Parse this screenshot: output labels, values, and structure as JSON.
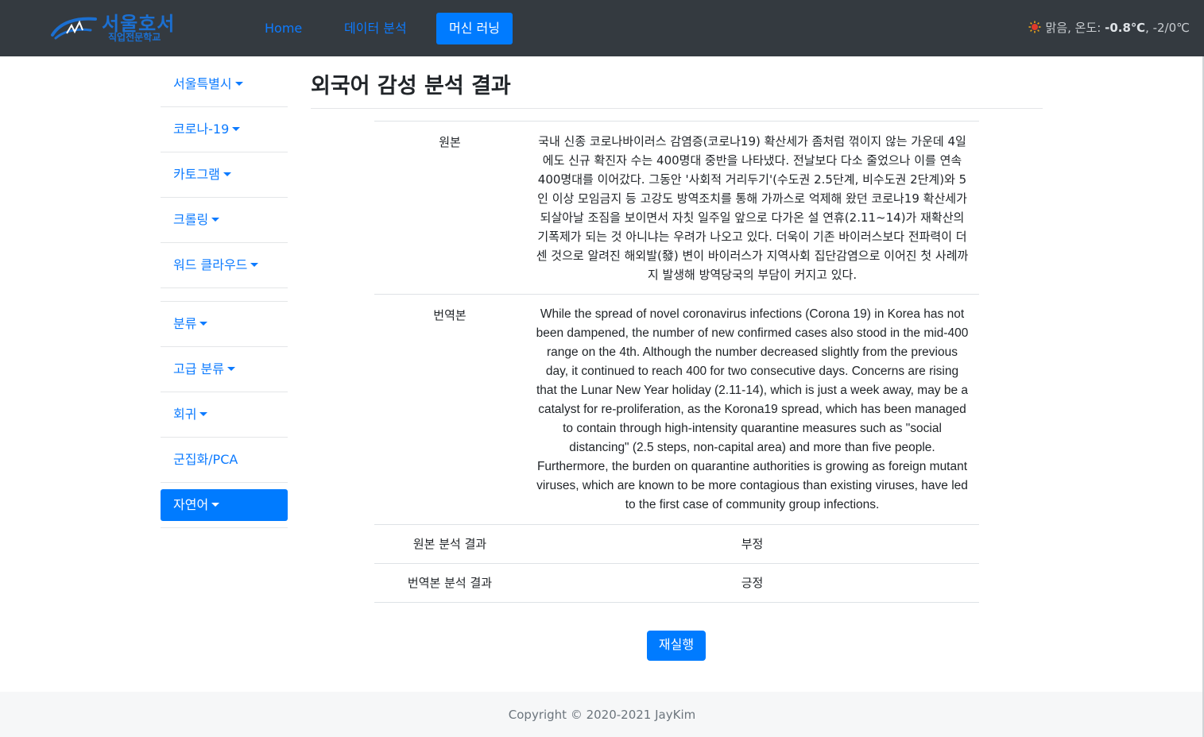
{
  "header": {
    "logo": {
      "line1": "서울호서",
      "line2": "직업전문학교"
    },
    "nav": [
      {
        "label": "Home",
        "active": false
      },
      {
        "label": "데이터 분석",
        "active": false
      },
      {
        "label": "머신 러닝",
        "active": true
      }
    ],
    "weather": {
      "icon": "sun-icon",
      "condition": "맑음, 온도: ",
      "temp": "-0.8℃",
      "range": ", -2/0℃"
    }
  },
  "sidebar": {
    "items": [
      {
        "label": "서울특별시",
        "dropdown": true
      },
      {
        "label": "코로나-19",
        "dropdown": true
      },
      {
        "label": "카토그램",
        "dropdown": true
      },
      {
        "label": "크롤링",
        "dropdown": true
      },
      {
        "label": "워드 클라우드",
        "dropdown": true
      },
      {
        "label": "분류",
        "dropdown": true
      },
      {
        "label": "고급 분류",
        "dropdown": true
      },
      {
        "label": "회귀",
        "dropdown": true
      },
      {
        "label": "군집화/PCA",
        "dropdown": false
      },
      {
        "label": "자연어",
        "dropdown": true,
        "active": true
      }
    ]
  },
  "main": {
    "title": "외국어 감성 분석 결과",
    "rows": {
      "original_label": "원본",
      "original_text": "국내 신종 코로나바이러스 감염증(코로나19) 확산세가 좀처럼 꺾이지 않는 가운데 4일에도 신규 확진자 수는 400명대 중반을 나타냈다. 전날보다 다소 줄었으나 이를 연속 400명대를 이어갔다. 그동안 '사회적 거리두기'(수도권 2.5단계, 비수도권 2단계)와 5인 이상 모임금지 등 고강도 방역조치를 통해 가까스로 억제해 왔던 코로나19 확산세가 되살아날 조짐을 보이면서 자칫 일주일 앞으로 다가온 설 연휴(2.11~14)가 재확산의 기폭제가 되는 것 아니냐는 우려가 나오고 있다. 더욱이 기존 바이러스보다 전파력이 더 센 것으로 알려진 해외발(發) 변이 바이러스가 지역사회 집단감염으로 이어진 첫 사례까지 발생해 방역당국의 부담이 커지고 있다.",
      "translated_label": "번역본",
      "translated_text": "While the spread of novel coronavirus infections (Corona 19) in Korea has not been dampened, the number of new confirmed cases also stood in the mid-400 range on the 4th. Although the number decreased slightly from the previous day, it continued to reach 400 for two consecutive days. Concerns are rising that the Lunar New Year holiday (2.11-14), which is just a week away, may be a catalyst for re-proliferation, as the Korona19 spread, which has been managed to contain through high-intensity quarantine measures such as \"social distancing\" (2.5 steps, non-capital area) and more than five people. Furthermore, the burden on quarantine authorities is growing as foreign mutant viruses, which are known to be more contagious than existing viruses, have led to the first case of community group infections.",
      "original_result_label": "원본 분석 결과",
      "original_result": "부정",
      "translated_result_label": "번역본 분석 결과",
      "translated_result": "긍정"
    },
    "rerun_label": "재실행"
  },
  "footer": {
    "copyright": "Copyright © 2020-2021 JayKim"
  },
  "colors": {
    "navbar_bg": "#343a40",
    "link": "#007bff",
    "active_bg": "#007bff",
    "footer_bg": "#f6f7f8"
  }
}
